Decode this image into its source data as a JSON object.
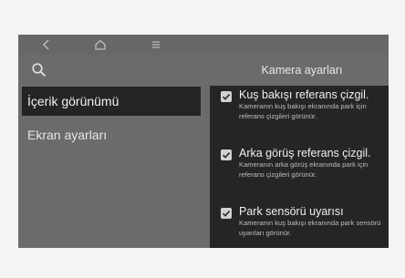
{
  "left_menu": {
    "items": [
      "İçerik görünümü",
      "Ekran ayarları"
    ]
  },
  "right": {
    "title": "Kamera ayarları",
    "options": [
      {
        "label": "Kuş bakışı referans çizgil.",
        "desc": "Kameranın kuş bakışı ekranında park için referans çizgileri görünür.",
        "checked": true
      },
      {
        "label": "Arka görüş referans çizgil.",
        "desc": "Kameranın arka görüş ekranında park için referans çizgileri görünür.",
        "checked": true
      },
      {
        "label": "Park sensörü uyarısı",
        "desc": "Kameranın kuş bakışı ekranında park sensörü uyarıları görünür.",
        "checked": true
      }
    ]
  },
  "icons": [
    "back-icon",
    "home-icon",
    "menu-icon",
    "search-icon",
    "checkmark-icon"
  ],
  "colors": {
    "page": "#f4f4f4",
    "screen": "#6b6b6b",
    "panel": "#252525",
    "selected": "#242424"
  }
}
